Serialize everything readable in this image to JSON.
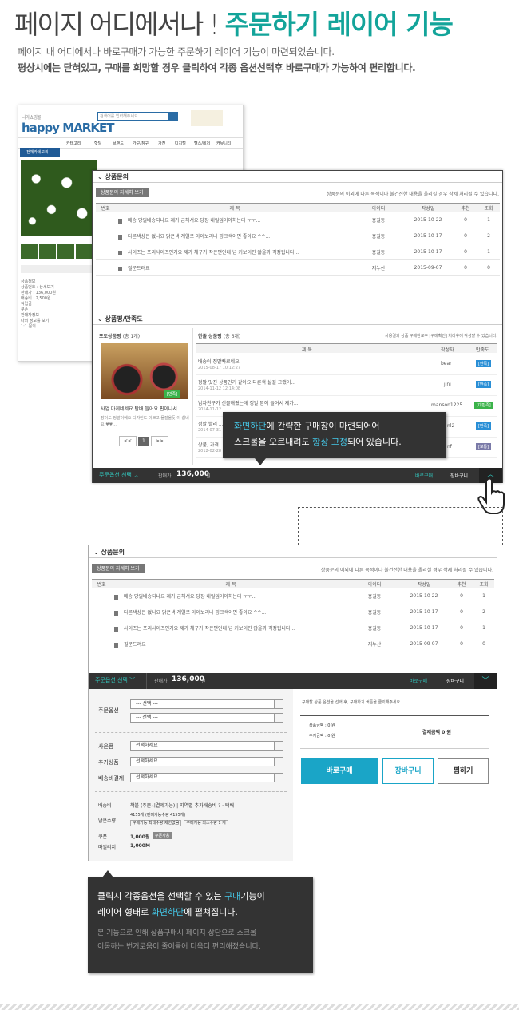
{
  "heading": {
    "plain": "페이지 어디에서나 ! ",
    "highlight": "주문하기 레이어 기능"
  },
  "intro": {
    "line1": "페이지 내 어디에서나 바로구매가 가능한 주문하기 레이어 기능이 마련되었습니다.",
    "line2": "평상시에는 닫혀있고, 구매를 희망할 경우 클릭하여 각종 옵션선택후 바로구매가 가능하여 편리합니다."
  },
  "shop": {
    "logo": "happy MARKET",
    "logo_small": "나의 쇼핑몰",
    "search_placeholder": "검색어를 입력해주세요.",
    "nav": [
      "카테고리",
      "핫딜",
      "브랜드",
      "가구/침구",
      "가전",
      "디지털",
      "헬스/레저",
      "커뮤니티"
    ],
    "category_button": "전체카테고리",
    "sidebar_lines": [
      "상품정보",
      "상품번호 : 상세보기",
      "판매가 : 136,000원",
      "배송비 : 2,500원",
      "적립금",
      "쿠폰",
      "판매자정보",
      "나의 정보를 보기",
      "1:1 문의"
    ]
  },
  "qa": {
    "title": "상품문의",
    "button": "상품문의 자세히 보기",
    "note": "상품문의 이외에 다른 목적이나 불건전한 내용을 올리실 경우 삭제 처리될 수 있습니다.",
    "headers": [
      "번호",
      "제 목",
      "아이디",
      "작성일",
      "추천",
      "조회"
    ],
    "rows": [
      {
        "title": "배송 당일배송되나요 제가 급해서요 당장 내일입어야하는데 ㅜㅜ...",
        "id": "홍길동",
        "date": "2015-10-22",
        "rec": "0",
        "view": "1"
      },
      {
        "title": "다른색상은 없나요 밝은색 계열로 아이보리나 핑크색이면 좋아요 ^^...",
        "id": "홍길동",
        "date": "2015-10-17",
        "rec": "0",
        "view": "2"
      },
      {
        "title": "사이즈는 프리사이즈인가요 제가 체구가 작은편인데 넘 커보이진 않을까 걱정됩니다...",
        "id": "홍길동",
        "date": "2015-10-17",
        "rec": "0",
        "view": "1"
      },
      {
        "title": "질문드려요",
        "id": "지누산",
        "date": "2015-09-07",
        "rec": "0",
        "view": "0"
      }
    ]
  },
  "review": {
    "title": "상품평/만족도",
    "photo_title": "포토상품평",
    "photo_count": "(총 1개)",
    "text_title": "한줄 상품평",
    "text_count": "(총 6개)",
    "note": "사용결과 상품 구매완료후 [구매확인] 처리후에 작성할 수 있습니다.",
    "photo_caption": "사업 마케네세요 탐배 들어요 핀이나서 ...",
    "photo_sub": "장이도 정말이에요 디자인도 이쁘고 물잘올듯 이 쉽네요 ♥♥...",
    "photo_badge": "[만족]",
    "pager": [
      "<<",
      "1",
      ">>"
    ],
    "headers": [
      "제 목",
      "작성자",
      "만족도"
    ],
    "rows": [
      {
        "title": "배송이 정말빠르네요",
        "date": "2015-08-17 10:12:27",
        "author": "bear",
        "badge": "[만족]",
        "color": "#2a8fd6"
      },
      {
        "title": "정말 맛진 상품인거 같아요 다른색 살걸 그랬어...",
        "date": "2014-11-12 12:14:08",
        "author": "jini",
        "badge": "[만족]",
        "color": "#2a8fd6"
      },
      {
        "title": "남자친구가 선물해줬는데 정말 맘에 들어서 제가...",
        "date": "2014-11-12",
        "author": "manson1225",
        "badge": "[대만족]",
        "color": "#3bb34a"
      },
      {
        "title": "정말 빨리 ...",
        "date": "2014-07-31",
        "author": "nl2",
        "badge": "[만족]",
        "color": "#2a8fd6"
      },
      {
        "title": "상품, 가격...",
        "date": "2012-02-28",
        "author": "nf",
        "badge": "[보통]",
        "color": "#7a7aa8"
      }
    ]
  },
  "tooltip1": {
    "part1": "화면하단",
    "part2": "에 간략한 구매창이 마련되어어",
    "part3": "스크롤을 오르내려도 ",
    "part4": "항상 고정",
    "part5": "되어 있습니다."
  },
  "bar": {
    "toggle": "주문옵션 선택",
    "price_label": "판매가",
    "price": "136,000",
    "won": "원",
    "buy": "바로구매",
    "cart": "장바구니"
  },
  "options": {
    "order_option_label": "주문옵션",
    "select_placeholder": "--- 선택 ---",
    "fields": [
      {
        "label": "사은품",
        "value": "선택하세요"
      },
      {
        "label": "추가상품",
        "value": "선택하세요"
      },
      {
        "label": "배송비결제",
        "value": "선택하세요"
      }
    ],
    "shipping_label": "배송비",
    "shipping_value": "착불 (주문시결제가능) | 지역별 추가배송비 ? · 택배",
    "remain_label": "남은수량",
    "remain_value": "4155개 (판매가능수량 4155개)",
    "remain_min": "구매가능 최대수량 제한없음",
    "remain_max": "구매가능 최소수량 1 개",
    "coupon_label": "쿠폰",
    "coupon_value": "1,000원",
    "coupon_btn": "쿠폰사용",
    "mileage_label": "마일리지",
    "mileage_value": "1,000M",
    "guide": "구매할 상품 옵션을 선택 후, 구매하기 버튼을 클릭해주세요.",
    "product_amount": "상품금액 : 0 원",
    "extra_amount": "추가금액 : 0 원",
    "pay_amount": "결제금액  0 원",
    "buy_btn": "바로구매",
    "cart_btn": "장바구니",
    "wish_btn": "찜하기"
  },
  "tooltip2": {
    "part1": "클릭시 각종옵션을 선택할 수 있는 ",
    "part2": "구매",
    "part3": "기능이",
    "part4": "레이어 형태로 ",
    "part5": "화면하단",
    "part6": "에 펼쳐집니다.",
    "desc1": "본 기능으로 인해 상품구매시 페이지 상단으로 스크롤",
    "desc2": "이동하는 번거로움이 줄어들어 더욱더 편리해졌습니다."
  }
}
